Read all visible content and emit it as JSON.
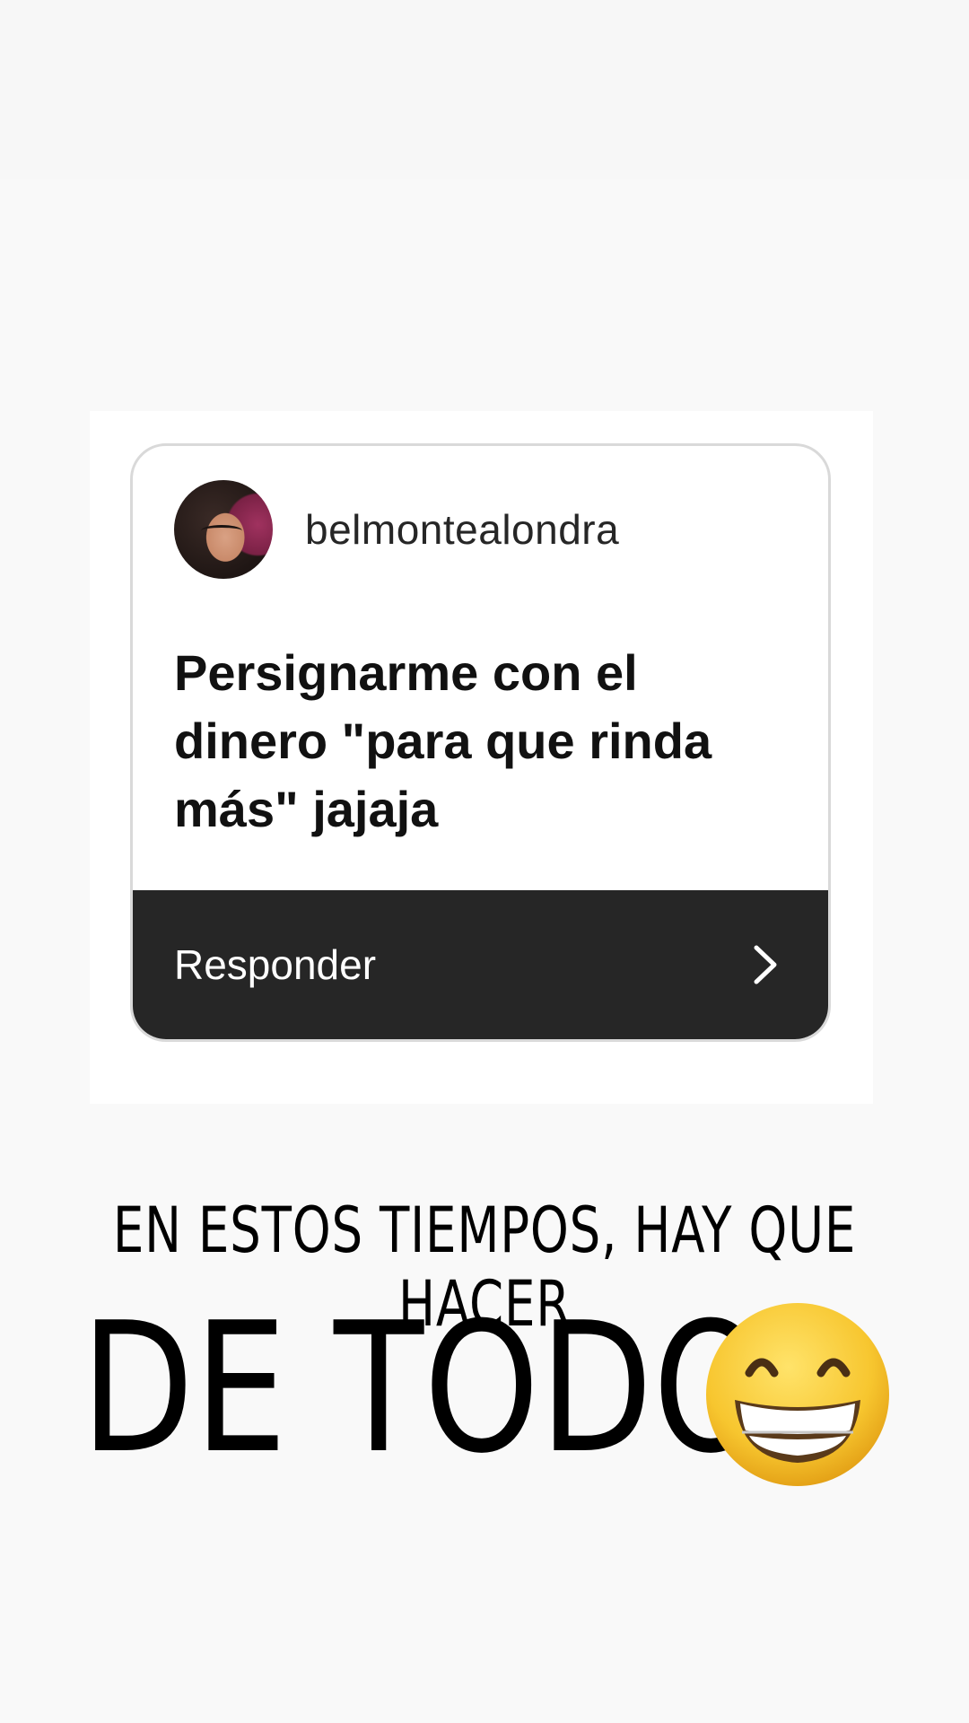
{
  "card": {
    "username": "belmontealondra",
    "question_lines": [
      "Persignarme con el",
      "dinero \"para que rinda",
      "más\" jajaja"
    ],
    "reply_label": "Responder"
  },
  "caption": {
    "line1": "EN ESTOS TIEMPOS, HAY QUE HACER",
    "line2": "DE TODO"
  },
  "icons": {
    "avatar": "profile-photo",
    "reply_chevron": "chevron-right-icon",
    "emoji": "grinning-face-with-smiling-eyes-emoji"
  },
  "colors": {
    "background": "#f9f9f9",
    "reply_bar": "#262626",
    "emoji_yellow": "#f7c62f"
  }
}
